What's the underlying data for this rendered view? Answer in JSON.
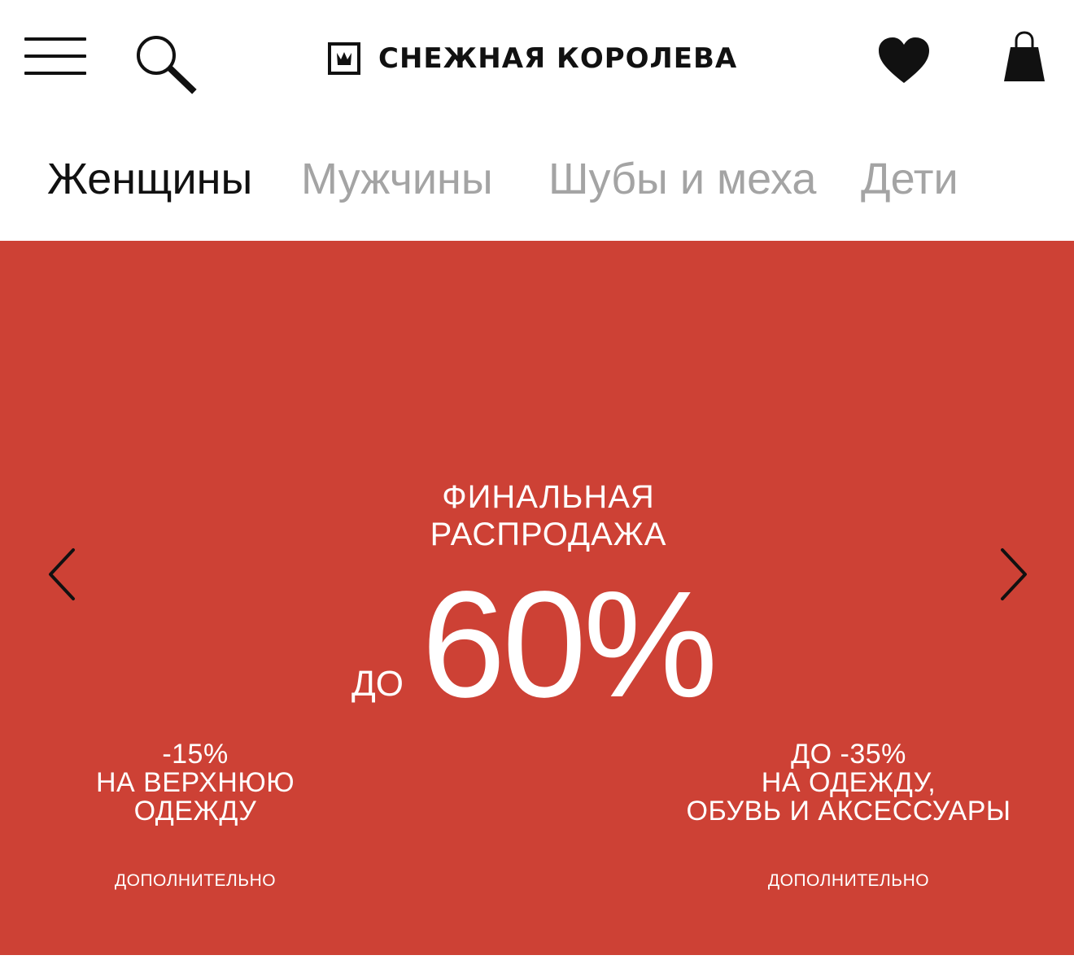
{
  "header": {
    "brand": "СНЕЖНАЯ КОРОЛЕВА",
    "icons": {
      "menu": "menu-icon",
      "search": "search-icon",
      "logo": "crown-icon",
      "wishlist": "heart-icon",
      "cart": "shopping-bag-icon"
    }
  },
  "tabs": [
    {
      "label": "Женщины",
      "active": true
    },
    {
      "label": "Мужчины",
      "active": false
    },
    {
      "label": "Шубы и меха",
      "active": false
    },
    {
      "label": "Дети",
      "active": false
    }
  ],
  "banner": {
    "background_color": "#cd4135",
    "headline": [
      "ФИНАЛЬНАЯ",
      "РАСПРОДАЖА"
    ],
    "discount_prefix": "ДО",
    "discount_value": "60%",
    "promo_left": {
      "title": [
        "-15%",
        "НА ВЕРХНЮЮ",
        "ОДЕЖДУ"
      ],
      "note": "ДОПОЛНИТЕЛЬНО"
    },
    "promo_right": {
      "title": [
        "ДО -35%",
        "НА ОДЕЖДУ,",
        "ОБУВЬ И АКСЕССУАРЫ"
      ],
      "note": "ДОПОЛНИТЕЛЬНО"
    },
    "icons": {
      "prev": "chevron-left-icon",
      "next": "chevron-right-icon"
    }
  }
}
